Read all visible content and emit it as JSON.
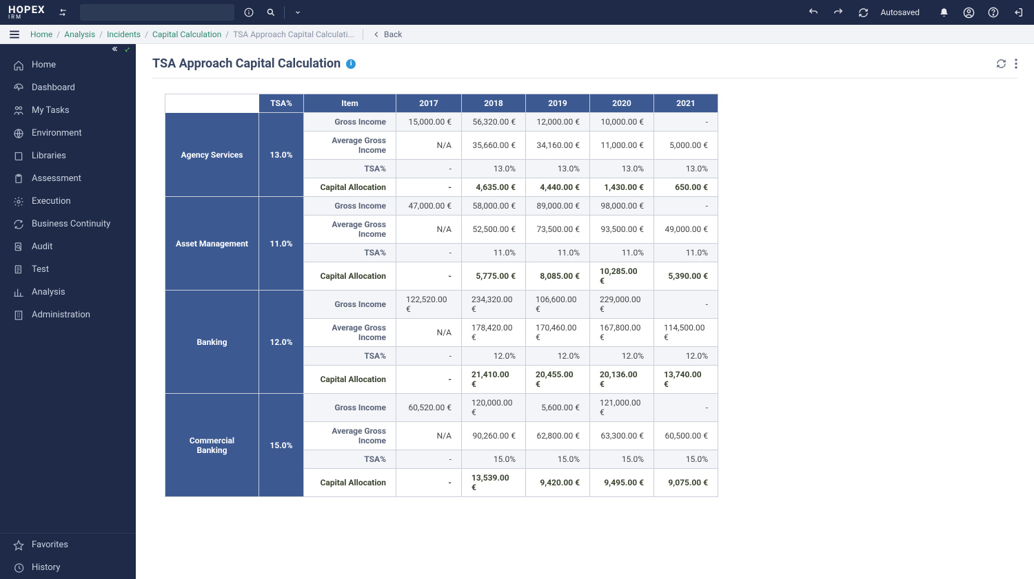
{
  "brand": {
    "name": "HOPEX",
    "sub": "IRM"
  },
  "topbar": {
    "autosaved": "Autosaved"
  },
  "breadcrumbs": [
    "Home",
    "Analysis",
    "Incidents",
    "Capital Calculation",
    "TSA Approach Capital Calculati..."
  ],
  "back_label": "Back",
  "sidebar": {
    "items": [
      {
        "icon": "home",
        "label": "Home"
      },
      {
        "icon": "gauge",
        "label": "Dashboard"
      },
      {
        "icon": "tasks",
        "label": "My Tasks"
      },
      {
        "icon": "globe",
        "label": "Environment"
      },
      {
        "icon": "book",
        "label": "Libraries"
      },
      {
        "icon": "clipboard",
        "label": "Assessment"
      },
      {
        "icon": "gear",
        "label": "Execution"
      },
      {
        "icon": "sync",
        "label": "Business Continuity"
      },
      {
        "icon": "search-doc",
        "label": "Audit"
      },
      {
        "icon": "flask",
        "label": "Test"
      },
      {
        "icon": "chart",
        "label": "Analysis"
      },
      {
        "icon": "building",
        "label": "Administration"
      }
    ],
    "bottom": [
      {
        "icon": "star",
        "label": "Favorites"
      },
      {
        "icon": "history",
        "label": "History"
      }
    ]
  },
  "page": {
    "title": "TSA Approach Capital Calculation"
  },
  "table": {
    "cols": [
      "",
      "TSA%",
      "Item",
      "2017",
      "2018",
      "2019",
      "2020",
      "2021"
    ],
    "groups": [
      {
        "name": "Agency Services",
        "tsa": "13.0%",
        "rows": [
          {
            "item": "Gross Income",
            "v": [
              "15,000.00 €",
              "56,320.00 €",
              "12,000.00 €",
              "10,000.00 €",
              "-"
            ]
          },
          {
            "item": "Average Gross Income",
            "v": [
              "N/A",
              "35,660.00 €",
              "34,160.00 €",
              "11,000.00 €",
              "5,000.00 €"
            ]
          },
          {
            "item": "TSA%",
            "v": [
              "-",
              "13.0%",
              "13.0%",
              "13.0%",
              "13.0%"
            ]
          },
          {
            "item": "Capital Allocation",
            "cap": true,
            "v": [
              "-",
              "4,635.00 €",
              "4,440.00 €",
              "1,430.00 €",
              "650.00 €"
            ]
          }
        ]
      },
      {
        "name": "Asset Management",
        "tsa": "11.0%",
        "rows": [
          {
            "item": "Gross Income",
            "v": [
              "47,000.00 €",
              "58,000.00 €",
              "89,000.00 €",
              "98,000.00 €",
              "-"
            ]
          },
          {
            "item": "Average Gross Income",
            "v": [
              "N/A",
              "52,500.00 €",
              "73,500.00 €",
              "93,500.00 €",
              "49,000.00 €"
            ]
          },
          {
            "item": "TSA%",
            "v": [
              "-",
              "11.0%",
              "11.0%",
              "11.0%",
              "11.0%"
            ]
          },
          {
            "item": "Capital Allocation",
            "cap": true,
            "v": [
              "-",
              "5,775.00 €",
              "8,085.00 €",
              "10,285.00 €",
              "5,390.00 €"
            ]
          }
        ]
      },
      {
        "name": "Banking",
        "tsa": "12.0%",
        "rows": [
          {
            "item": "Gross Income",
            "v": [
              "122,520.00 €",
              "234,320.00 €",
              "106,600.00 €",
              "229,000.00 €",
              "-"
            ]
          },
          {
            "item": "Average Gross Income",
            "v": [
              "N/A",
              "178,420.00 €",
              "170,460.00 €",
              "167,800.00 €",
              "114,500.00 €"
            ]
          },
          {
            "item": "TSA%",
            "v": [
              "-",
              "12.0%",
              "12.0%",
              "12.0%",
              "12.0%"
            ]
          },
          {
            "item": "Capital Allocation",
            "cap": true,
            "v": [
              "-",
              "21,410.00 €",
              "20,455.00 €",
              "20,136.00 €",
              "13,740.00 €"
            ]
          }
        ]
      },
      {
        "name": "Commercial Banking",
        "tsa": "15.0%",
        "rows": [
          {
            "item": "Gross Income",
            "v": [
              "60,520.00 €",
              "120,000.00 €",
              "5,600.00 €",
              "121,000.00 €",
              "-"
            ]
          },
          {
            "item": "Average Gross Income",
            "v": [
              "N/A",
              "90,260.00 €",
              "62,800.00 €",
              "63,300.00 €",
              "60,500.00 €"
            ]
          },
          {
            "item": "TSA%",
            "v": [
              "-",
              "15.0%",
              "15.0%",
              "15.0%",
              "15.0%"
            ]
          },
          {
            "item": "Capital Allocation",
            "cap": true,
            "v": [
              "-",
              "13,539.00 €",
              "9,420.00 €",
              "9,495.00 €",
              "9,075.00 €"
            ]
          }
        ]
      }
    ]
  }
}
